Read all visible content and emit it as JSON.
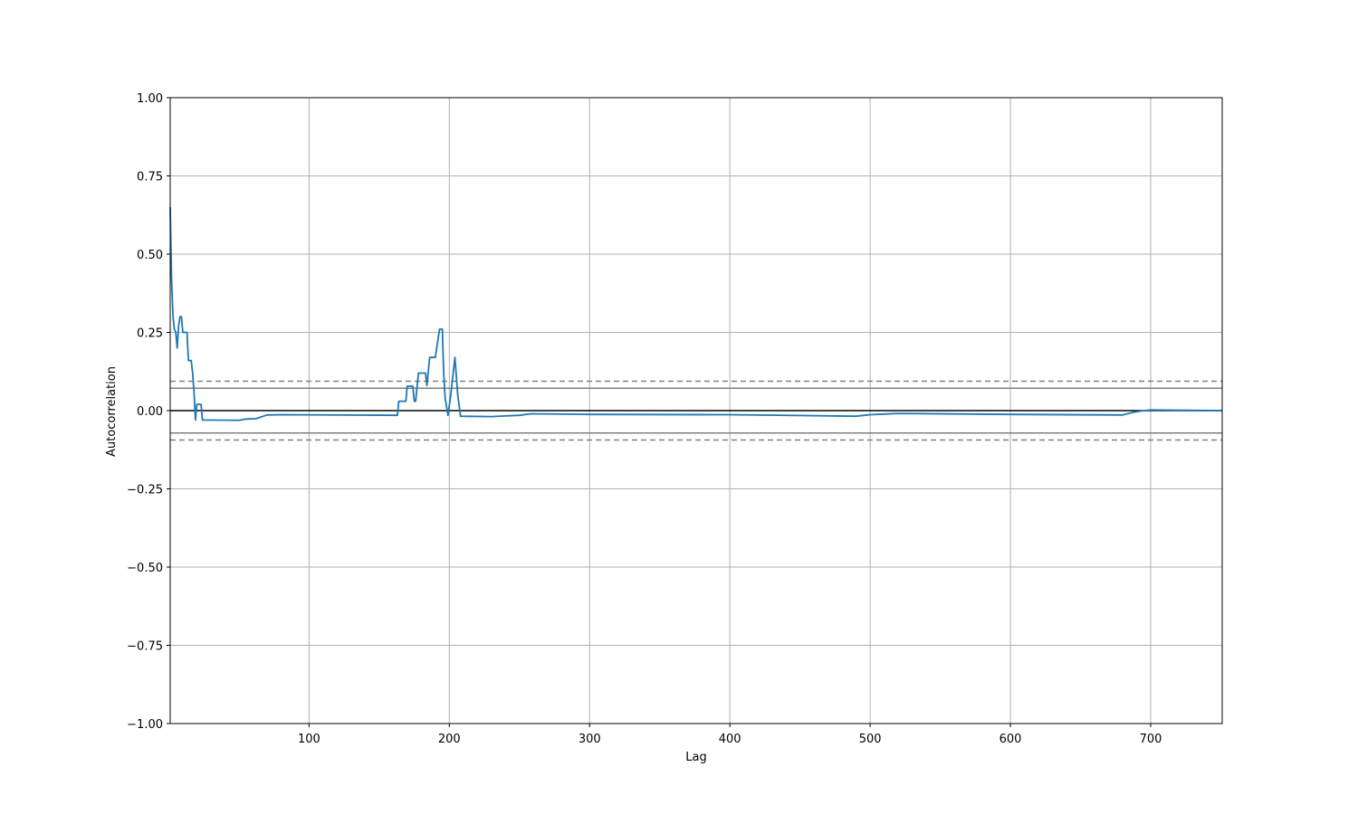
{
  "chart_data": {
    "type": "line",
    "title": "",
    "xlabel": "Lag",
    "ylabel": "Autocorrelation",
    "xlim": [
      1,
      751
    ],
    "ylim": [
      -1.0,
      1.0
    ],
    "grid": true,
    "x_ticks": [
      100,
      200,
      300,
      400,
      500,
      600,
      700
    ],
    "x_tick_labels": [
      "100",
      "200",
      "300",
      "400",
      "500",
      "600",
      "700"
    ],
    "y_ticks": [
      -1.0,
      -0.75,
      -0.5,
      -0.25,
      0.0,
      0.25,
      0.5,
      0.75,
      1.0
    ],
    "y_tick_labels": [
      "−1.00",
      "−0.75",
      "−0.50",
      "−0.25",
      "0.00",
      "0.25",
      "0.50",
      "0.75",
      "1.00"
    ],
    "confidence_bands": {
      "z95": 0.0716,
      "z99": 0.0941
    },
    "colors": {
      "series": "#1f77b4",
      "grid": "#b0b0b0",
      "zero_line": "#000000",
      "band": "#808080"
    },
    "series": [
      {
        "values": [
          [
            1,
            0.65
          ],
          [
            2,
            0.42
          ],
          [
            3,
            0.3
          ],
          [
            4,
            0.26
          ],
          [
            5,
            0.25
          ],
          [
            6,
            0.2
          ],
          [
            7,
            0.27
          ],
          [
            8,
            0.3
          ],
          [
            9,
            0.3
          ],
          [
            10,
            0.25
          ],
          [
            13,
            0.25
          ],
          [
            14,
            0.16
          ],
          [
            16,
            0.16
          ],
          [
            17,
            0.12
          ],
          [
            18,
            0.06
          ],
          [
            19,
            -0.03
          ],
          [
            20,
            0.02
          ],
          [
            23,
            0.02
          ],
          [
            24,
            -0.03
          ],
          [
            50,
            -0.031
          ],
          [
            55,
            -0.027
          ],
          [
            62,
            -0.026
          ],
          [
            70,
            -0.014
          ],
          [
            80,
            -0.013
          ],
          [
            163,
            -0.015
          ],
          [
            164,
            0.03
          ],
          [
            169,
            0.03
          ],
          [
            170,
            0.078
          ],
          [
            174,
            0.078
          ],
          [
            175,
            0.03
          ],
          [
            176,
            0.03
          ],
          [
            178,
            0.12
          ],
          [
            183,
            0.12
          ],
          [
            184,
            0.08
          ],
          [
            186,
            0.17
          ],
          [
            190,
            0.17
          ],
          [
            193,
            0.26
          ],
          [
            195,
            0.26
          ],
          [
            196,
            0.12
          ],
          [
            197,
            0.04
          ],
          [
            199,
            -0.015
          ],
          [
            201,
            0.05
          ],
          [
            204,
            0.17
          ],
          [
            206,
            0.05
          ],
          [
            208,
            -0.018
          ],
          [
            230,
            -0.019
          ],
          [
            240,
            -0.017
          ],
          [
            250,
            -0.015
          ],
          [
            258,
            -0.01
          ],
          [
            300,
            -0.012
          ],
          [
            400,
            -0.013
          ],
          [
            490,
            -0.018
          ],
          [
            500,
            -0.013
          ],
          [
            510,
            -0.011
          ],
          [
            520,
            -0.009
          ],
          [
            600,
            -0.012
          ],
          [
            680,
            -0.014
          ],
          [
            688,
            -0.005
          ],
          [
            695,
            0.0
          ],
          [
            700,
            0.002
          ],
          [
            751,
            0.0
          ]
        ]
      }
    ]
  }
}
